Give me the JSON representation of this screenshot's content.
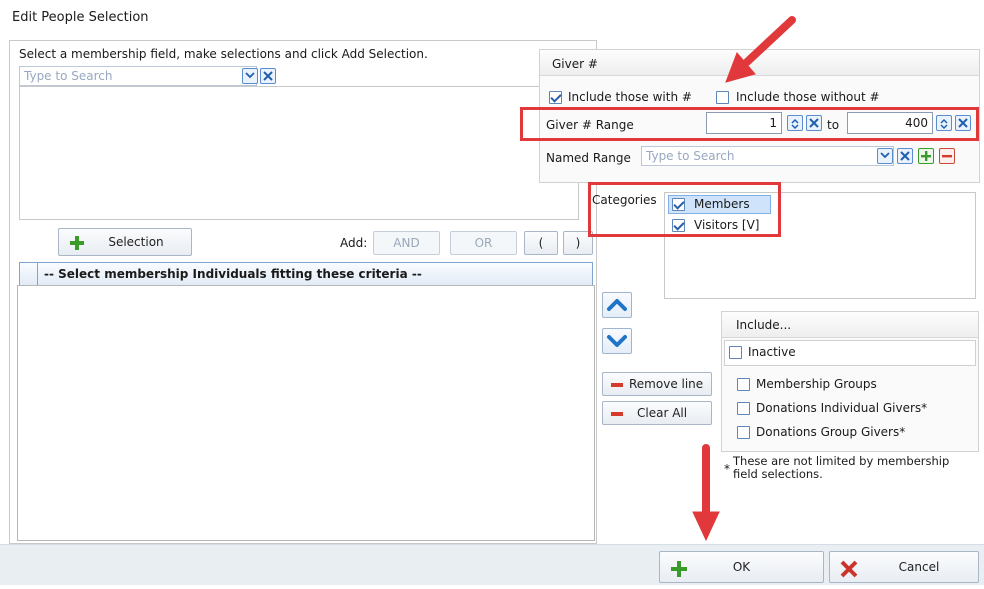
{
  "window": {
    "title": "Edit People Selection"
  },
  "left": {
    "instruction": "Select a membership field, make selections and click Add Selection.",
    "search_placeholder": "Type to Search",
    "add_selection_label": "Selection",
    "add_label": "Add:",
    "and_label": "AND",
    "or_label": "OR",
    "open_paren": "(",
    "close_paren": ")",
    "criteria_header": "-- Select membership Individuals fitting these criteria --"
  },
  "giver": {
    "group_title": "Giver #",
    "include_with_label": "Include those with #",
    "include_with_checked": true,
    "include_without_label": "Include those without #",
    "include_without_checked": false,
    "range_label": "Giver # Range",
    "range_from": "1",
    "range_to_label": "to",
    "range_to": "400",
    "named_range_label": "Named Range",
    "named_range_placeholder": "Type to Search"
  },
  "categories": {
    "label": "Categories",
    "items": [
      {
        "label": "Members",
        "checked": true,
        "selected": true
      },
      {
        "label": "Visitors [V]",
        "checked": true,
        "selected": false
      }
    ]
  },
  "line_actions": {
    "remove_line": "Remove line",
    "clear_all": "Clear All"
  },
  "include": {
    "title": "Include...",
    "inactive": "Inactive",
    "membership_groups": "Membership Groups",
    "donations_individual": "Donations Individual Givers*",
    "donations_group": "Donations Group Givers*",
    "footnote_mark": "*",
    "footnote": "These are not limited by membership field selections."
  },
  "footer": {
    "ok": "OK",
    "cancel": "Cancel"
  },
  "colors": {
    "accent": "#2a5fa8",
    "annotation_red": "#e1393b",
    "add_green": "#3a9a2a"
  }
}
